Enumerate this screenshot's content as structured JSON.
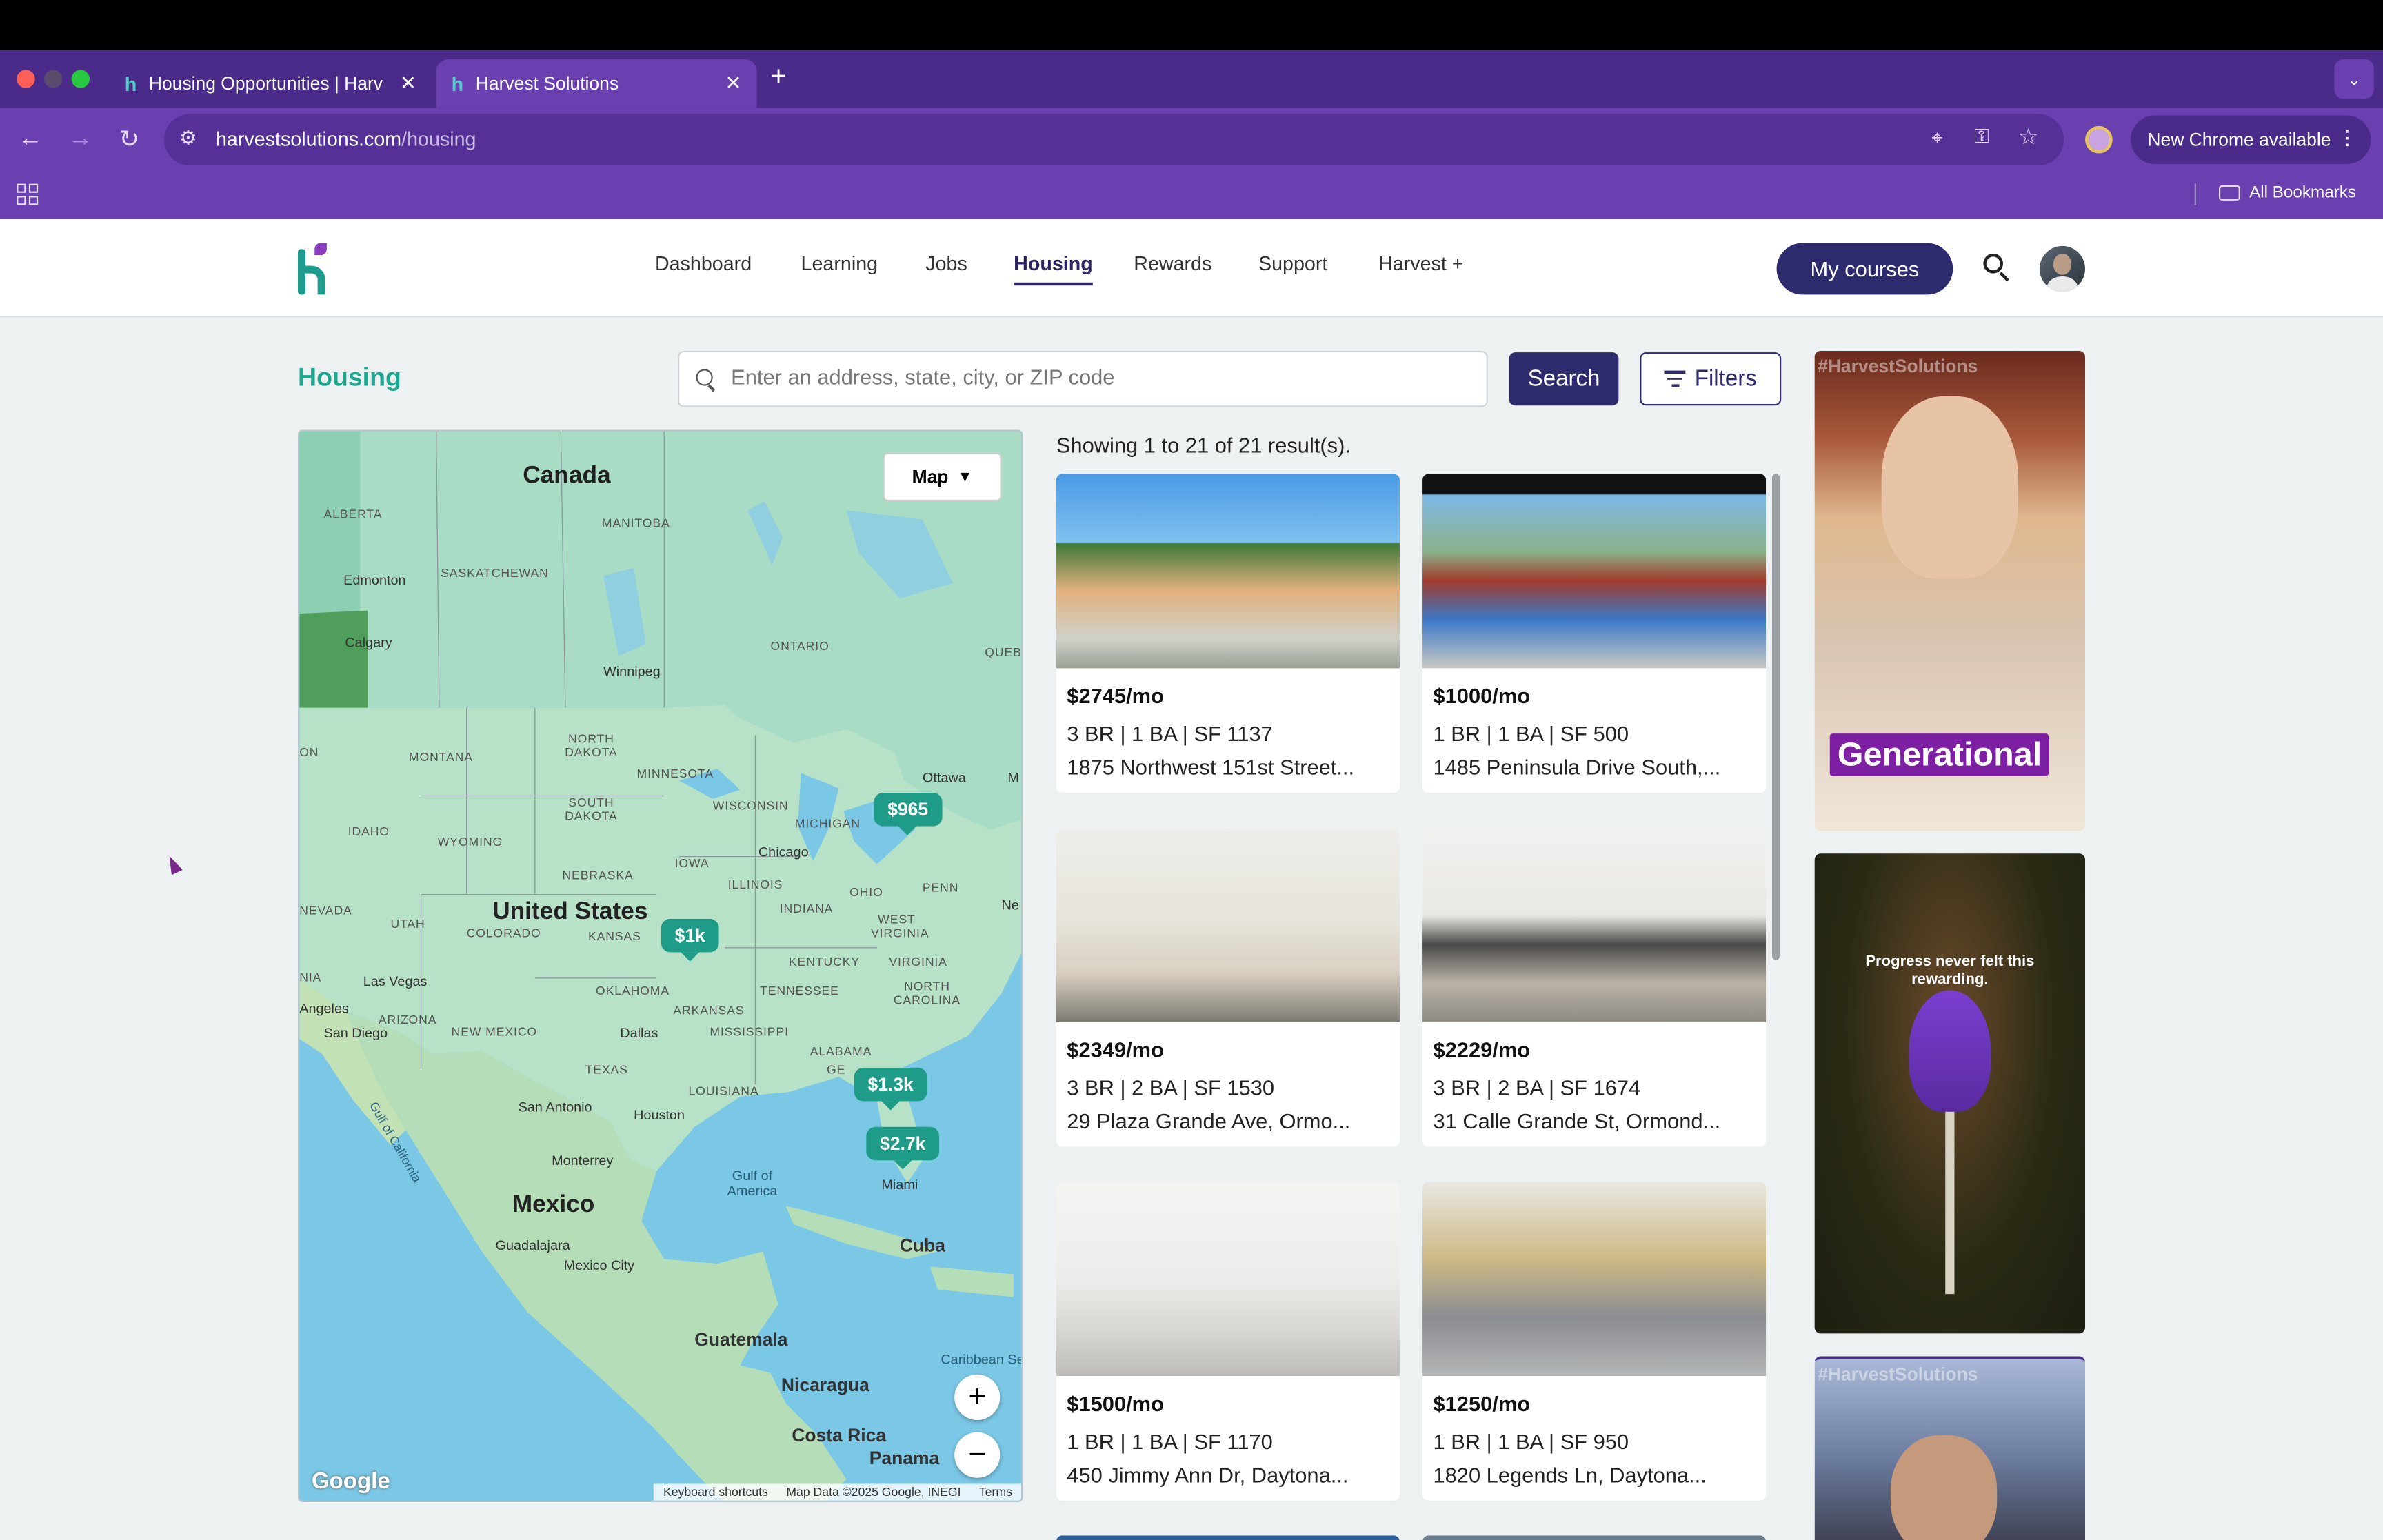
{
  "browser": {
    "tabs": [
      {
        "label": "Housing Opportunities | Harv",
        "favicon": "h"
      },
      {
        "label": "Harvest Solutions",
        "favicon": "h"
      }
    ],
    "new_tab": "+",
    "url_host": "harvestsolutions.com",
    "url_path": "/housing",
    "update_label": "New Chrome available",
    "bookmarks_label": "All Bookmarks"
  },
  "site": {
    "nav": [
      "Dashboard",
      "Learning",
      "Jobs",
      "Housing",
      "Rewards",
      "Support",
      "Harvest +"
    ],
    "active_nav": "Housing",
    "my_courses": "My courses"
  },
  "housing": {
    "title": "Housing",
    "search_placeholder": "Enter an address, state, city, or ZIP code",
    "search_button": "Search",
    "filters_button": "Filters",
    "results_count": "Showing 1 to 21 of 21 result(s)."
  },
  "map": {
    "type_button": "Map",
    "zoom_in": "+",
    "zoom_out": "−",
    "logo": "Google",
    "attribution": [
      "Keyboard shortcuts",
      "Map Data ©2025 Google, INEGI",
      "Terms"
    ],
    "markers": [
      "$965",
      "$1k",
      "$1.3k",
      "$2.7k"
    ],
    "labels": {
      "canada": "Canada",
      "alberta": "ALBERTA",
      "manitoba": "MANITOBA",
      "saskatchewan": "SASKATCHEWAN",
      "edmonton": "Edmonton",
      "calgary": "Calgary",
      "winnipeg": "Winnipeg",
      "ontario": "ONTARIO",
      "quebec": "QUEB",
      "montana": "MONTANA",
      "north_dakota": "NORTH DAKOTA",
      "minnesota": "MINNESOTA",
      "ottawa": "Ottawa",
      "south_dakota": "SOUTH DAKOTA",
      "wisconsin": "WISCONSIN",
      "michigan": "MICHIGAN",
      "idaho": "IDAHO",
      "wyoming": "WYOMING",
      "iowa": "IOWA",
      "chicago": "Chicago",
      "nebraska": "NEBRASKA",
      "illinois": "ILLINOIS",
      "ohio": "OHIO",
      "penn": "PENN",
      "nevada": "NEVADA",
      "utah": "UTAH",
      "united_states": "United States",
      "colorado": "COLORADO",
      "kansas": "KANSAS",
      "indiana": "INDIANA",
      "west_virginia": "WEST VIRGINIA",
      "kentucky": "KENTUCKY",
      "virginia": "VIRGINIA",
      "las_vegas": "Las Vegas",
      "oklahoma": "OKLAHOMA",
      "tennessee": "TENNESSEE",
      "north_carolina": "NORTH CAROLINA",
      "angeles": "Angeles",
      "arizona": "ARIZONA",
      "new_mexico": "NEW MEXICO",
      "dallas": "Dallas",
      "arkansas": "ARKANSAS",
      "mississippi": "MISSISSIPPI",
      "alabama": "ALABAMA",
      "san_diego": "San Diego",
      "texas": "TEXAS",
      "louisiana": "LOUISIANA",
      "ge": "GE",
      "san_antonio": "San Antonio",
      "houston": "Houston",
      "monterrey": "Monterrey",
      "gulf_mexico": "Gulf of America",
      "miami": "Miami",
      "mexico": "Mexico",
      "guadalajara": "Guadalajara",
      "mexico_city": "Mexico City",
      "cuba": "Cuba",
      "guatemala": "Guatemala",
      "nicaragua": "Nicaragua",
      "costa_rica": "Costa Rica",
      "panama": "Panama",
      "caribbean": "Caribbean Se",
      "gulf_california": "Gulf of California",
      "on": "ON",
      "nia": "NIA",
      "m": "M",
      "ne": "Ne"
    }
  },
  "listings": [
    {
      "price": "$2745/mo",
      "specs": "3 BR | 1 BA | SF 1137",
      "address": "1875 Northwest 151st Street..."
    },
    {
      "price": "$1000/mo",
      "specs": "1 BR | 1 BA | SF 500",
      "address": "1485 Peninsula Drive South,..."
    },
    {
      "price": "$2349/mo",
      "specs": "3 BR | 2 BA | SF 1530",
      "address": "29 Plaza Grande Ave, Ormo..."
    },
    {
      "price": "$2229/mo",
      "specs": "3 BR | 2 BA | SF 1674",
      "address": "31 Calle Grande St, Ormond..."
    },
    {
      "price": "$1500/mo",
      "specs": "1 BR | 1 BA | SF 1170",
      "address": "450 Jimmy Ann Dr, Daytona..."
    },
    {
      "price": "$1250/mo",
      "specs": "1 BR | 1 BA | SF 950",
      "address": "1820 Legends Ln, Daytona..."
    }
  ],
  "ads": {
    "hashtag": "#HarvestSolutions",
    "generational": "Generational",
    "progress_quote": "Progress never felt this rewarding.",
    "hashtag2": "#HarvestSolutions"
  },
  "colors": {
    "browser_frame": "#4b2b8a",
    "toolbar": "#6a3fb0",
    "brand_primary": "#2d2a6e",
    "brand_accent": "#1fa68f",
    "marker": "#1e9c88"
  }
}
